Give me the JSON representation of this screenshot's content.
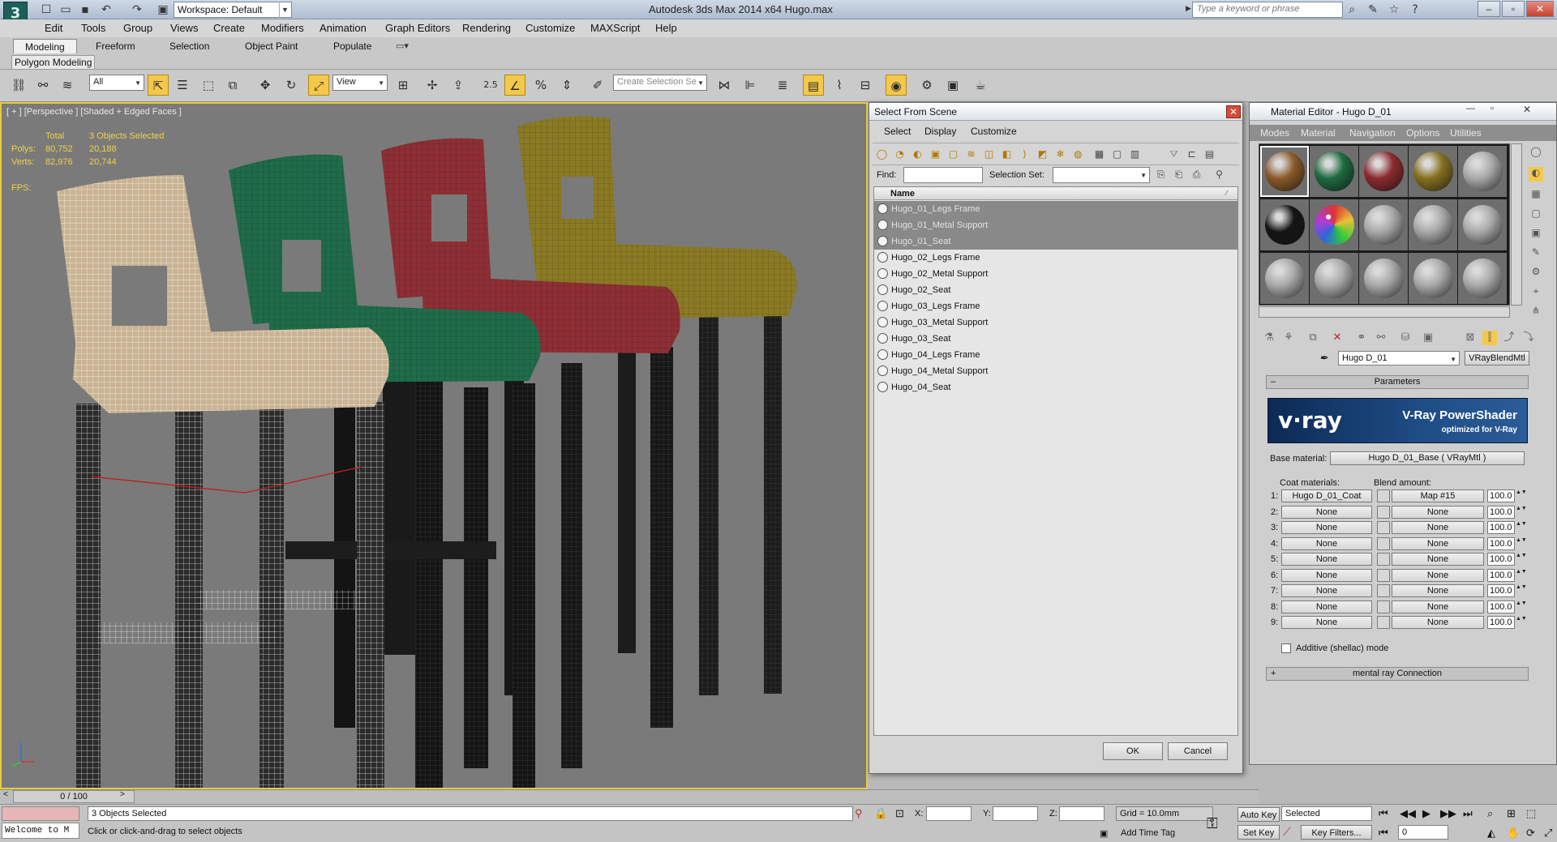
{
  "titlebar": {
    "workspace": "Workspace: Default",
    "title": "Autodesk 3ds Max  2014 x64      Hugo.max",
    "search_placeholder": "Type a keyword or phrase"
  },
  "menu": [
    "Edit",
    "Tools",
    "Group",
    "Views",
    "Create",
    "Modifiers",
    "Animation",
    "Graph Editors",
    "Rendering",
    "Customize",
    "MAXScript",
    "Help"
  ],
  "ribbon": {
    "tabs": [
      "Modeling",
      "Freeform",
      "Selection",
      "Object Paint",
      "Populate"
    ],
    "active_tab": "Modeling",
    "panel_label": "Polygon Modeling"
  },
  "toolbar": {
    "filter": "All",
    "ref_coord": "View",
    "selection_set": "Create Selection Se",
    "snap_value": "2.5"
  },
  "viewport": {
    "label": "[ + ] [Perspective ] [Shaded + Edged Faces ]",
    "stats_header_total": "Total",
    "stats_header_selected": "3 Objects Selected",
    "polys_label": "Polys:",
    "polys_total": "80,752",
    "polys_selected": "20,188",
    "verts_label": "Verts:",
    "verts_total": "82,976",
    "verts_selected": "20,744",
    "fps_label": "FPS:",
    "stool_colors": [
      "#c9b393",
      "#1f6b4a",
      "#8d2f35",
      "#8a7a24"
    ]
  },
  "timeline": {
    "position": "0 / 100"
  },
  "status": {
    "maxscript": "Welcome to M",
    "objects_selected": "3 Objects Selected",
    "prompt": "Click or click-and-drag to select objects",
    "x_label": "X:",
    "y_label": "Y:",
    "z_label": "Z:",
    "grid": "Grid = 10.0mm",
    "add_time_tag": "Add Time Tag",
    "auto_key": "Auto Key",
    "set_key": "Set Key",
    "key_mode": "Selected",
    "key_filters": "Key Filters...",
    "frame": "0"
  },
  "select_dialog": {
    "title": "Select From Scene",
    "tabs": [
      "Select",
      "Display",
      "Customize"
    ],
    "find_label": "Find:",
    "selection_set_label": "Selection Set:",
    "column_name": "Name",
    "items": [
      {
        "name": "Hugo_01_Legs Frame",
        "selected": true
      },
      {
        "name": "Hugo_01_Metal Support",
        "selected": true
      },
      {
        "name": "Hugo_01_Seat",
        "selected": true
      },
      {
        "name": "Hugo_02_Legs Frame",
        "selected": false
      },
      {
        "name": "Hugo_02_Metal Support",
        "selected": false
      },
      {
        "name": "Hugo_02_Seat",
        "selected": false
      },
      {
        "name": "Hugo_03_Legs Frame",
        "selected": false
      },
      {
        "name": "Hugo_03_Metal Support",
        "selected": false
      },
      {
        "name": "Hugo_03_Seat",
        "selected": false
      },
      {
        "name": "Hugo_04_Legs Frame",
        "selected": false
      },
      {
        "name": "Hugo_04_Metal Support",
        "selected": false
      },
      {
        "name": "Hugo_04_Seat",
        "selected": false
      }
    ],
    "ok": "OK",
    "cancel": "Cancel"
  },
  "material_editor": {
    "title": "Material Editor - Hugo D_01",
    "menu": [
      "Modes",
      "Material",
      "Navigation",
      "Options",
      "Utilities"
    ],
    "slot_colors": [
      "#8a5a2a",
      "#1d6a40",
      "#8c2a2e",
      "#857020",
      "#a9a9a9",
      "#151515",
      "rainbow",
      "#a9a9a9",
      "#a9a9a9",
      "#a9a9a9",
      "#a9a9a9",
      "#a9a9a9",
      "#a9a9a9",
      "#a9a9a9",
      "#a9a9a9"
    ],
    "material_name": "Hugo D_01",
    "material_type": "VRayBlendMtl",
    "parameters_label": "Parameters",
    "vray_logo": "v·ray",
    "vray_title": "V-Ray PowerShader",
    "vray_subtitle": "optimized for V-Ray",
    "base_material_label": "Base material:",
    "base_material": "Hugo D_01_Base  ( VRayMtl )",
    "coat_label": "Coat materials:",
    "blend_label": "Blend amount:",
    "coats": [
      {
        "idx": "1:",
        "mat": "Hugo D_01_Coat",
        "map": "Map #15",
        "amount": "100.0"
      },
      {
        "idx": "2:",
        "mat": "None",
        "map": "None",
        "amount": "100.0"
      },
      {
        "idx": "3:",
        "mat": "None",
        "map": "None",
        "amount": "100.0"
      },
      {
        "idx": "4:",
        "mat": "None",
        "map": "None",
        "amount": "100.0"
      },
      {
        "idx": "5:",
        "mat": "None",
        "map": "None",
        "amount": "100.0"
      },
      {
        "idx": "6:",
        "mat": "None",
        "map": "None",
        "amount": "100.0"
      },
      {
        "idx": "7:",
        "mat": "None",
        "map": "None",
        "amount": "100.0"
      },
      {
        "idx": "8:",
        "mat": "None",
        "map": "None",
        "amount": "100.0"
      },
      {
        "idx": "9:",
        "mat": "None",
        "map": "None",
        "amount": "100.0"
      }
    ],
    "additive_label": "Additive (shellac) mode",
    "mental_ray": "mental ray Connection"
  }
}
